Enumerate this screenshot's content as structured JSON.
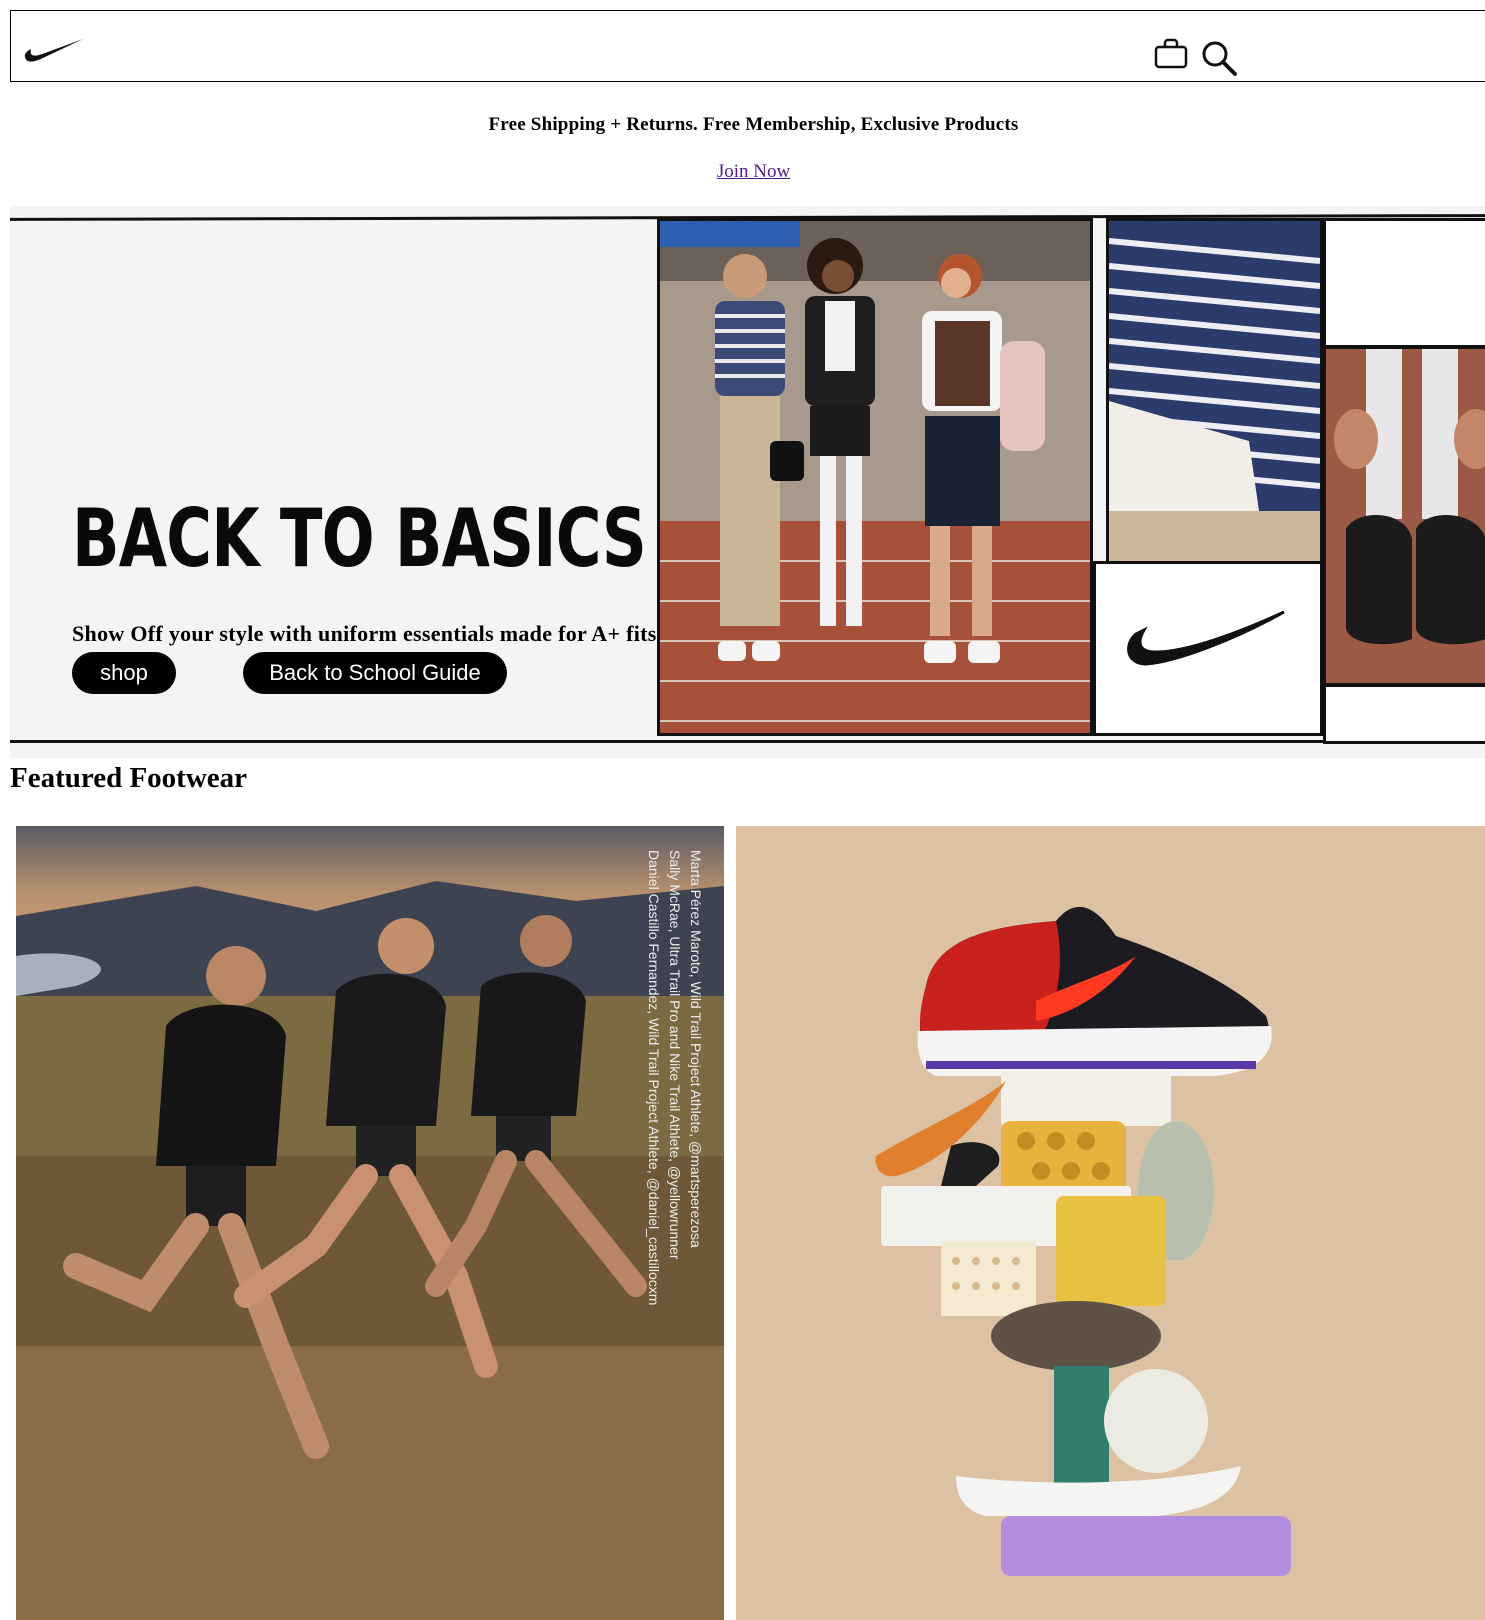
{
  "header": {
    "logo_icon": "nike-swoosh-logo",
    "bag_icon": "shopping-bag-icon",
    "search_icon": "search-icon"
  },
  "promo": {
    "text": "Free Shipping + Returns. Free Membership, Exclusive Products",
    "link": "Join Now"
  },
  "hero": {
    "title": "BACK TO BASICS",
    "subtitle": "Show Off your style with uniform essentials made for A+ fits.",
    "shop_button": "shop",
    "guide_button": "Back to School Guide"
  },
  "featured": {
    "title": "Featured Footwear",
    "left_card": {
      "captions": [
        "Marta Pérez Maroto, Wild Trail Project Athlete, @martsperezosa",
        "Sally McRae, Ultra Trail Pro and Nike Trail Athlete, @yellowrunner",
        "Daniel Castillo Fernandez, Wild Trail Project Athlete, @daniel_castillocxm"
      ]
    }
  },
  "colors": {
    "link": "#551a8b",
    "button_bg": "#000000",
    "hero_bg": "#f4f4f4",
    "shoe_bg": "#dcc2a3",
    "shoe_red": "#d6241f"
  }
}
